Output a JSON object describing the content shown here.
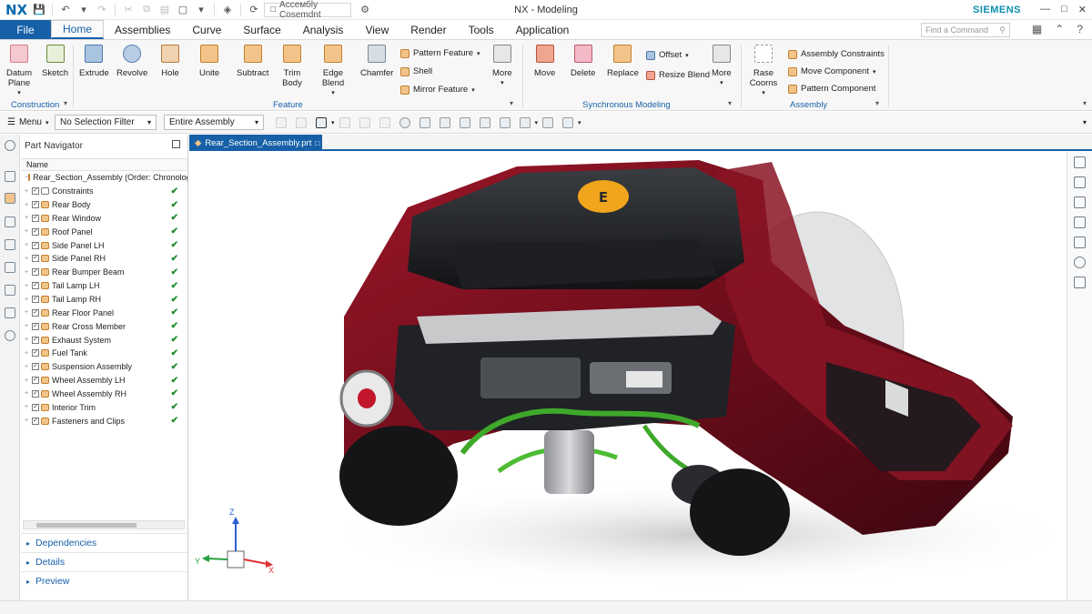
{
  "app": {
    "logo": "NX",
    "title": "NX - Modeling",
    "brand": "SIEMENS",
    "assembly_selector": "Ассембly Cosemdnt"
  },
  "tabs": {
    "file": "File",
    "items": [
      "Home",
      "Assemblies",
      "Curve",
      "Surface",
      "Analysis",
      "View",
      "Render",
      "Tools",
      "Application"
    ],
    "active": "Home"
  },
  "command_search": {
    "placeholder": "Find a Command"
  },
  "ribbon": {
    "construction": {
      "label": "Construction",
      "datum_plane": "Datum Plane",
      "sketch": "Sketch"
    },
    "feature": {
      "label": "Feature",
      "extrude": "Extrude",
      "revolve": "Revolve",
      "hole": "Hole",
      "unite": "Unite",
      "subtract": "Subtract",
      "trim_body": "Trim Body",
      "edge_blend": "Edge Blend",
      "chamfer": "Chamfer",
      "pattern_feature": "Pattern Feature",
      "shell": "Shell",
      "mirror_feature": "Mirror Feature",
      "more": "More"
    },
    "synchronous": {
      "label": "Synchronous Modeling",
      "move": "Move",
      "delete": "Delete",
      "replace": "Replace",
      "offset": "Offset",
      "resize_blend": "Resize Blend",
      "more": "More"
    },
    "assembly": {
      "label": "Assembly",
      "reuse_comps": "Rase Coorns",
      "assembly_constraints": "Assembly Constraints",
      "move_component": "Move Component",
      "pattern_component": "Pattern Component"
    }
  },
  "selection_bar": {
    "menu": "Menu",
    "filter": "No Selection Filter",
    "scope": "Entire Assembly"
  },
  "navigator": {
    "title": "Part Navigator",
    "column": "Name",
    "root": "Rear_Section_Assembly (Order: Chronologic",
    "items": [
      "Constraints",
      "Rear Body",
      "Rear Window",
      "Roof Panel",
      "Side Panel LH",
      "Side Panel RH",
      "Rear Bumper Beam",
      "Tail Lamp LH",
      "Tail Lamp RH",
      "Rear Floor Panel",
      "Rear Cross Member",
      "Exhaust System",
      "Fuel Tank",
      "Suspension Assembly",
      "Wheel Assembly LH",
      "Wheel Assembly RH",
      "Interior Trim",
      "Fasteners and Clips"
    ],
    "panels": [
      "Dependencies",
      "Details",
      "Preview"
    ]
  },
  "document": {
    "tab": "Rear_Section_Assembly.prt"
  },
  "viewport": {
    "triad": {
      "x": "X",
      "y": "Y",
      "z": "Z"
    },
    "badge": "E"
  },
  "colors": {
    "accent": "#1660a8",
    "body_red": "#7a1020",
    "check_green": "#1f8a2a",
    "pipe_green": "#3fa82b",
    "badge_yellow": "#f1a51c"
  }
}
